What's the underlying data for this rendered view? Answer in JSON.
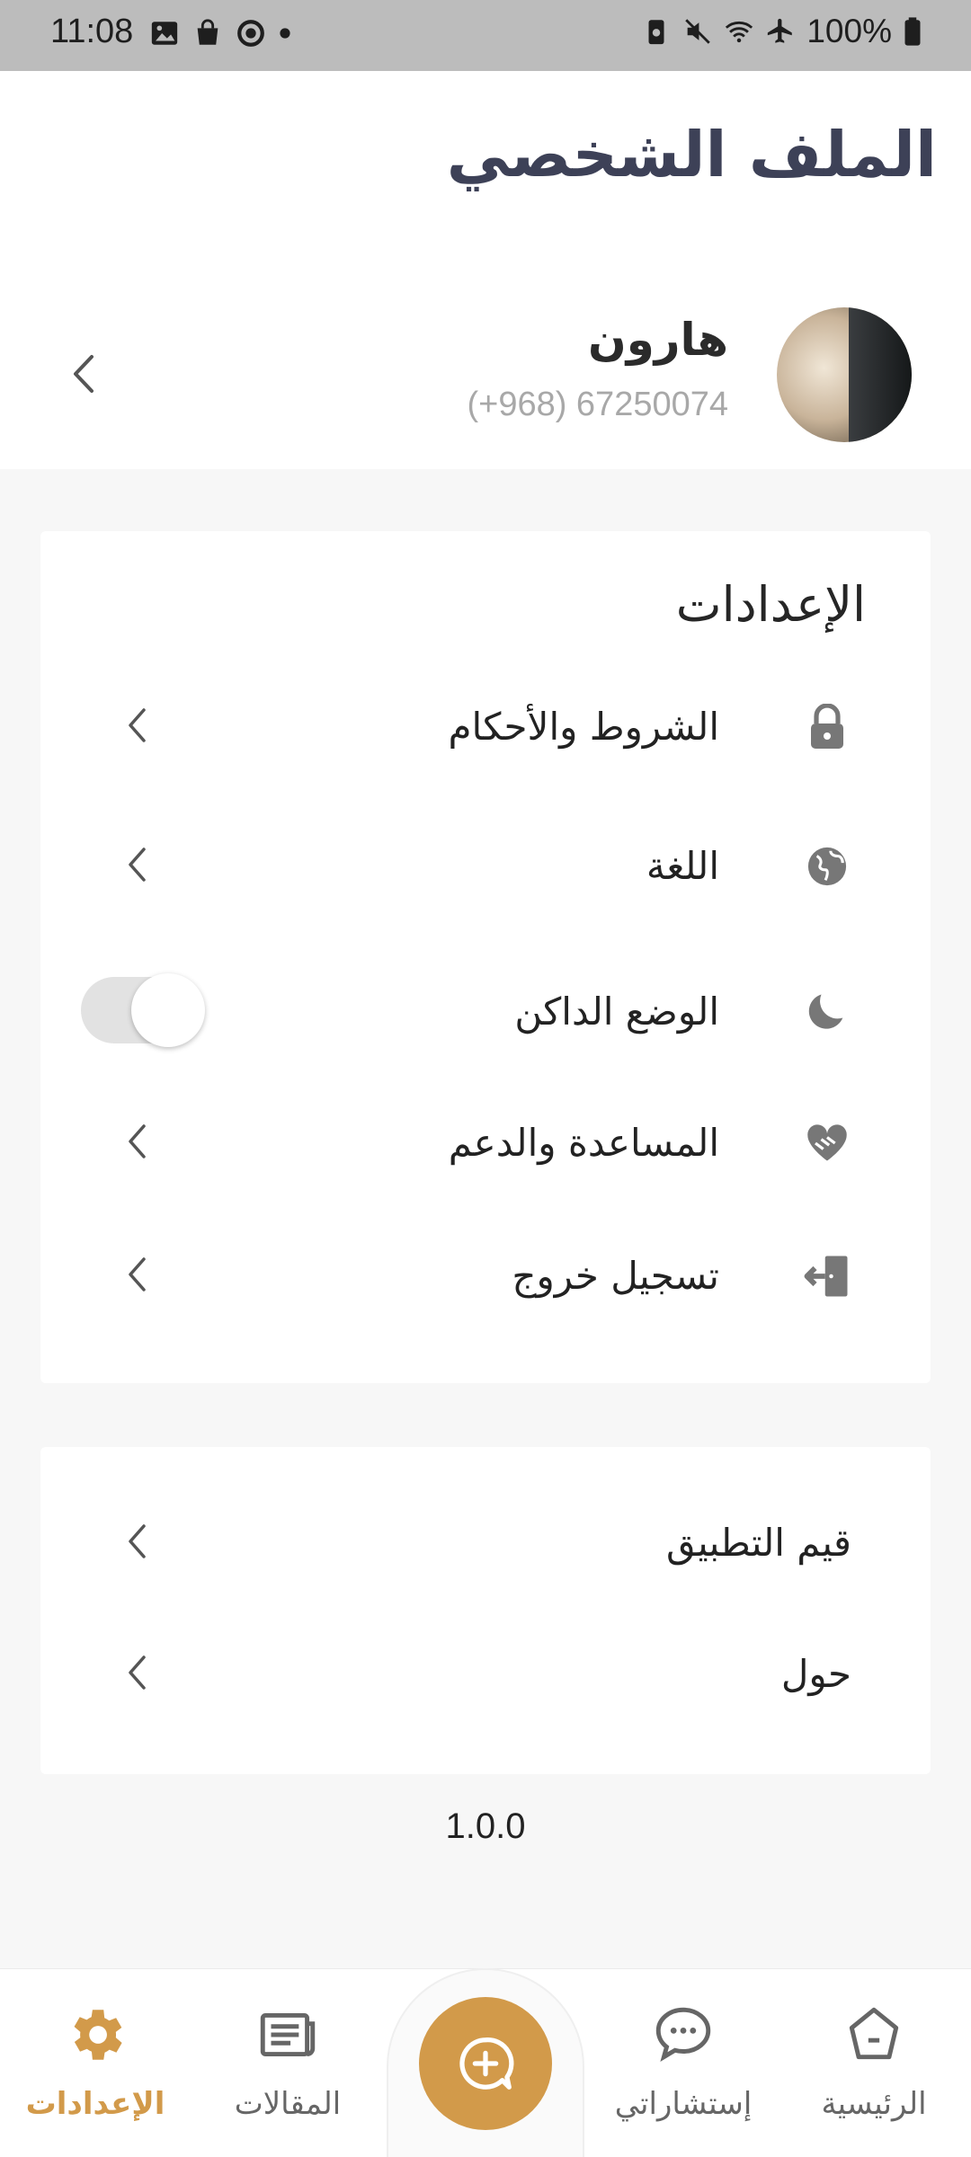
{
  "status_bar": {
    "time": "11:08",
    "battery": "100%",
    "left_icons": [
      "image-icon",
      "bag-icon",
      "sync-icon",
      "dot-icon"
    ],
    "right_icons": [
      "battery-saver-icon",
      "mute-icon",
      "wifi-icon",
      "airplane-icon",
      "battery-icon"
    ]
  },
  "header": {
    "title": "الملف الشخصي"
  },
  "profile": {
    "name": "هارون",
    "phone": "(+968) 67250074"
  },
  "settings": {
    "section_title": "الإعدادات",
    "items": [
      {
        "label": "الشروط والأحكام",
        "icon": "lock-icon"
      },
      {
        "label": "اللغة",
        "icon": "globe-icon"
      },
      {
        "label": "الوضع الداكن",
        "icon": "moon-icon",
        "toggle": false
      },
      {
        "label": "المساعدة والدعم",
        "icon": "handshake-heart-icon"
      },
      {
        "label": "تسجيل خروج",
        "icon": "logout-icon"
      }
    ]
  },
  "about": {
    "items": [
      {
        "label": "قيم التطبيق"
      },
      {
        "label": "حول"
      }
    ]
  },
  "version": "1.0.0",
  "bottom_nav": {
    "items": [
      {
        "label": "الإعدادات",
        "icon": "gear-icon",
        "active": true
      },
      {
        "label": "المقالات",
        "icon": "newspaper-icon",
        "active": false
      },
      {
        "label": "إستشاراتي",
        "icon": "chat-bubble-icon",
        "active": false
      },
      {
        "label": "الرئيسية",
        "icon": "home-icon",
        "active": false
      }
    ],
    "fab_icon": "add-chat-icon"
  },
  "colors": {
    "accent": "#d29a4a",
    "title": "#3d4157",
    "icon_gray": "#777777",
    "background": "#f7f7f7"
  }
}
